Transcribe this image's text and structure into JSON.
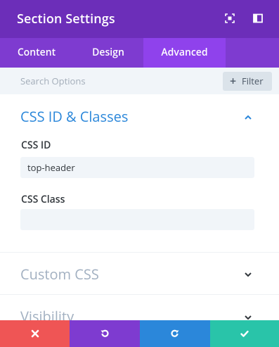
{
  "header": {
    "title": "Section Settings",
    "icons": [
      "expand-icon",
      "sidebar-toggle-icon"
    ]
  },
  "tabs": [
    {
      "label": "Content",
      "active": false
    },
    {
      "label": "Design",
      "active": false
    },
    {
      "label": "Advanced",
      "active": true
    }
  ],
  "search": {
    "placeholder": "Search Options",
    "filter_label": "Filter"
  },
  "sections": [
    {
      "title": "CSS ID & Classes",
      "expanded": true,
      "fields": [
        {
          "label": "CSS ID",
          "value": "top-header",
          "placeholder": ""
        },
        {
          "label": "CSS Class",
          "value": "",
          "placeholder": ""
        }
      ]
    },
    {
      "title": "Custom CSS",
      "expanded": false
    },
    {
      "title": "Visibility",
      "expanded": false
    }
  ],
  "footer": {
    "buttons": [
      {
        "name": "discard",
        "icon": "close-icon",
        "color": "#ef5555"
      },
      {
        "name": "undo",
        "icon": "undo-icon",
        "color": "#7e3bd0"
      },
      {
        "name": "redo",
        "icon": "redo-icon",
        "color": "#2b87da"
      },
      {
        "name": "save",
        "icon": "check-icon",
        "color": "#29c4a9"
      }
    ]
  },
  "colors": {
    "header": "#6c2eb9",
    "tab_bar": "#7e3bd0",
    "tab_active": "#8f42ec",
    "accent_blue": "#2b87da",
    "muted_title": "#a2b0c1"
  }
}
